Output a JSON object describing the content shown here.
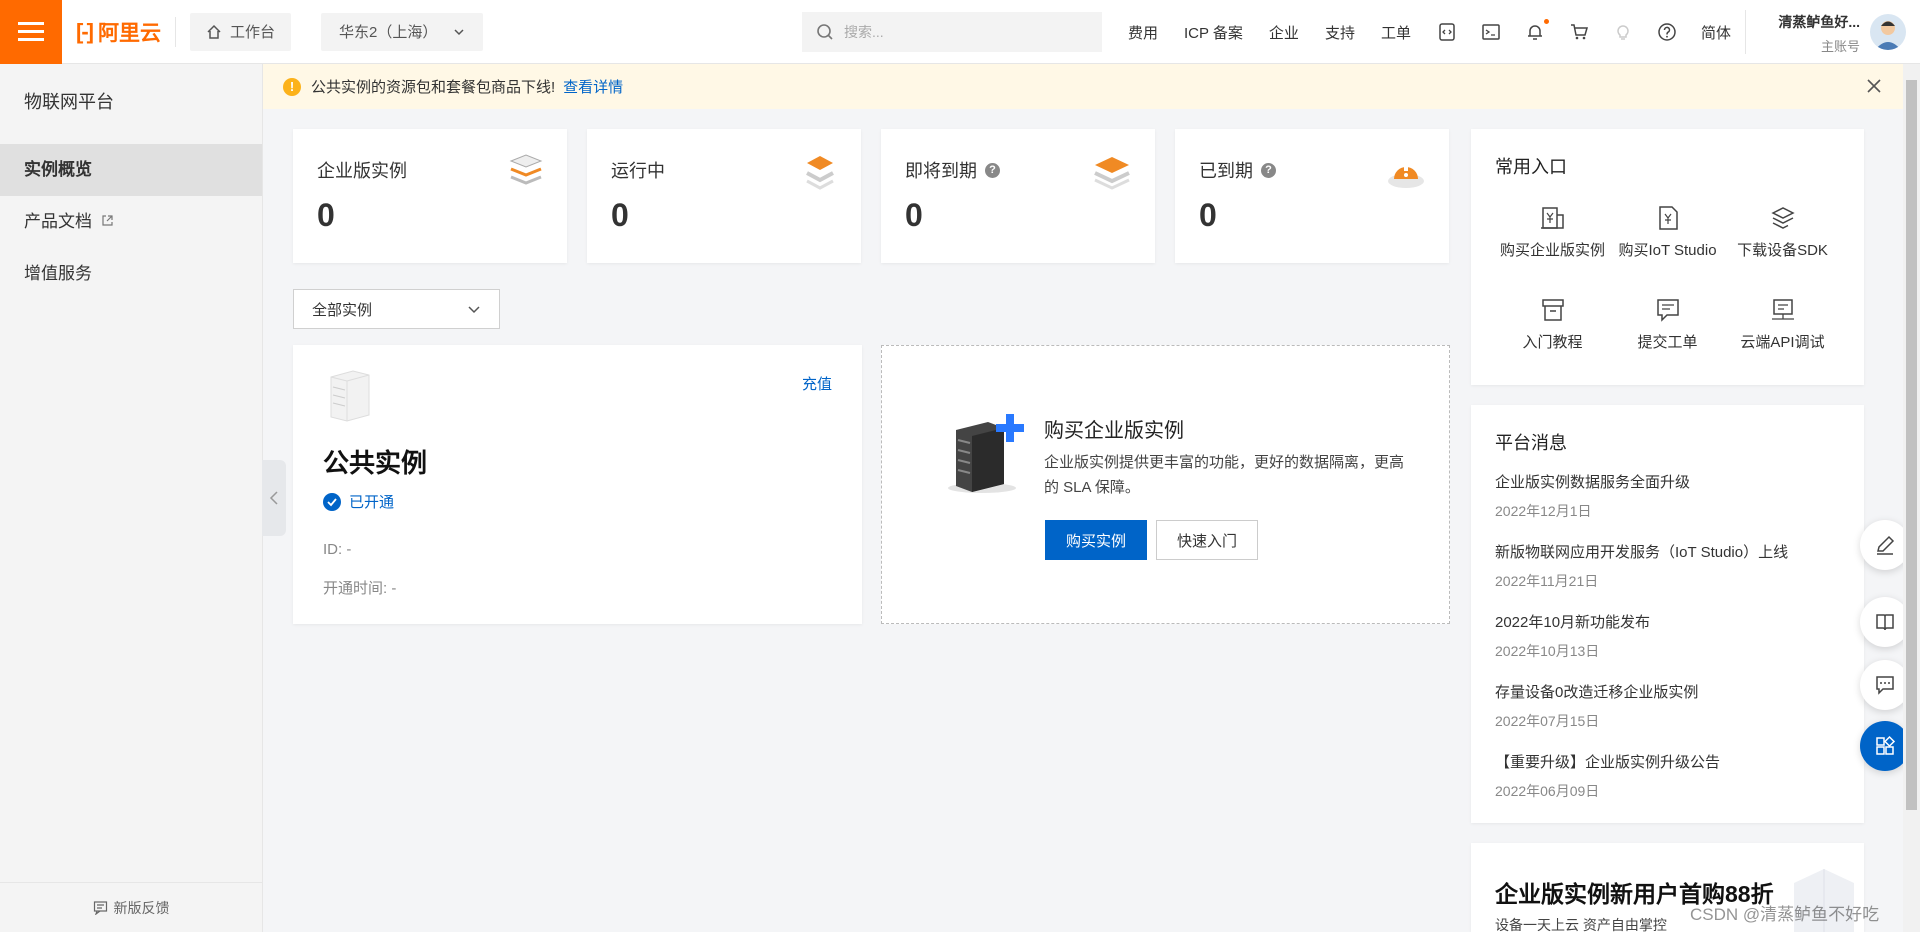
{
  "header": {
    "logo_text": "阿里云",
    "workbench": "工作台",
    "region": "华东2（上海）",
    "search_placeholder": "搜索...",
    "links": [
      "费用",
      "ICP 备案",
      "企业",
      "支持",
      "工单"
    ],
    "lang": "简体",
    "user_name": "清蒸鲈鱼好...",
    "user_role": "主账号"
  },
  "sidebar": {
    "title": "物联网平台",
    "items": [
      {
        "label": "实例概览",
        "active": true
      },
      {
        "label": "产品文档",
        "active": false
      },
      {
        "label": "增值服务",
        "active": false
      }
    ],
    "feedback": "新版反馈"
  },
  "notice": {
    "text": "公共实例的资源包和套餐包商品下线!",
    "link": "查看详情"
  },
  "stats": [
    {
      "label": "企业版实例",
      "value": "0"
    },
    {
      "label": "运行中",
      "value": "0"
    },
    {
      "label": "即将到期",
      "value": "0"
    },
    {
      "label": "已到期",
      "value": "0"
    }
  ],
  "filter": {
    "selected": "全部实例"
  },
  "public_instance": {
    "recharge": "充值",
    "title": "公共实例",
    "status": "已开通",
    "id_line": "ID: -",
    "time_line": "开通时间: -"
  },
  "buy_card": {
    "title": "购买企业版实例",
    "desc": "企业版实例提供更丰富的功能，更好的数据隔离，更高的 SLA 保障。",
    "primary_btn": "购买实例",
    "secondary_btn": "快速入门"
  },
  "quick_entries": {
    "title": "常用入口",
    "items": [
      "购买企业版实例",
      "购买IoT Studio",
      "下载设备SDK",
      "入门教程",
      "提交工单",
      "云端API调试"
    ]
  },
  "messages": {
    "title": "平台消息",
    "items": [
      {
        "title": "企业版实例数据服务全面升级",
        "date": "2022年12月1日"
      },
      {
        "title": "新版物联网应用开发服务（IoT Studio）上线",
        "date": "2022年11月21日"
      },
      {
        "title": "2022年10月新功能发布",
        "date": "2022年10月13日"
      },
      {
        "title": "存量设备0改造迁移企业版实例",
        "date": "2022年07月15日"
      },
      {
        "title": "【重要升级】企业版实例升级公告",
        "date": "2022年06月09日"
      }
    ]
  },
  "promo": {
    "title": "企业版实例新用户首购88折",
    "subtitle": "设备一天上云 资产自由掌控"
  },
  "watermark": "CSDN @清蒸鲈鱼不好吃",
  "colors": {
    "brand": "#ff6a00",
    "primary": "#0064c8",
    "notice_bg": "#fff8e6"
  }
}
